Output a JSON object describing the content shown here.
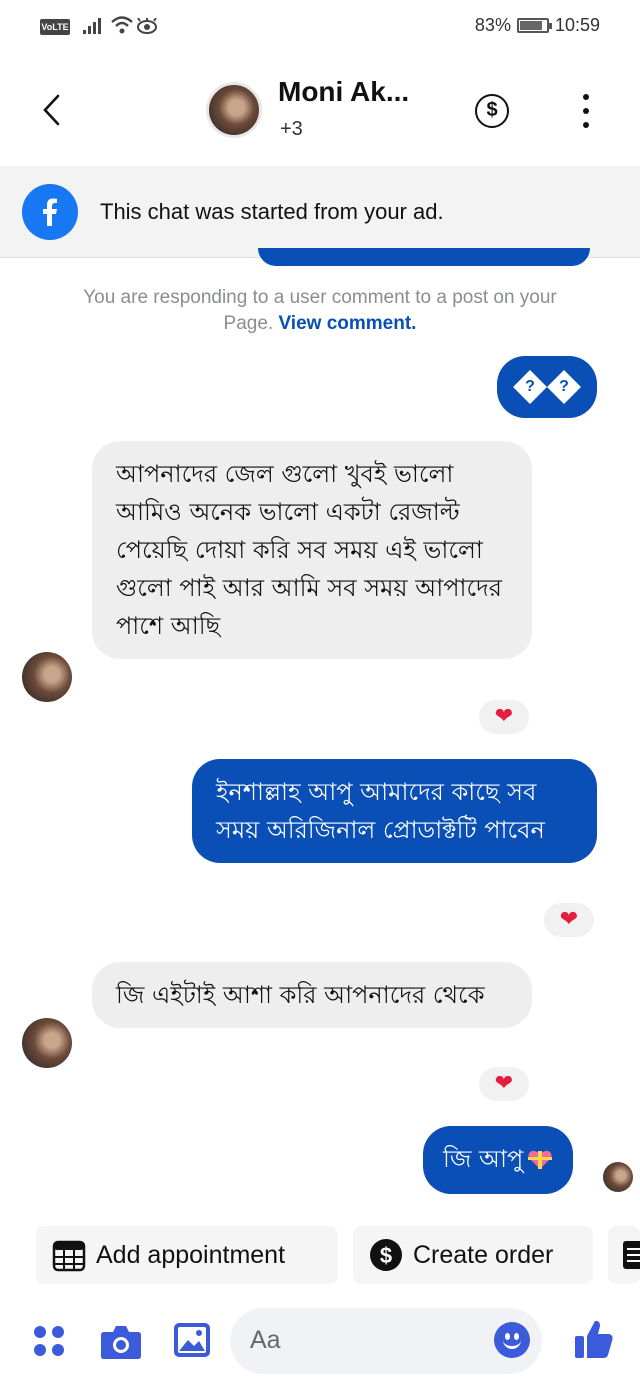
{
  "status_bar": {
    "volte": "VoLTE",
    "battery_percent": "83%",
    "battery_level": 0.83,
    "time": "10:59"
  },
  "header": {
    "title": "Moni Ak...",
    "subtitle": "+3"
  },
  "banner": {
    "text": "This chat was started from your ad."
  },
  "notice": {
    "text": "You are responding to a user comment to a post on your Page.",
    "link": "View comment."
  },
  "messages": [
    {
      "side": "out",
      "text": "",
      "glyphs": [
        "?",
        "?"
      ]
    },
    {
      "side": "in",
      "text": "আপনাদের জেল গুলো খুবই ভালো আমিও অনেক ভালো একটা রেজাল্ট পেয়েছি দোয়া করি সব সময় এই ভালো গুলো পাই আর আমি সব সময় আপাদের পাশে আছি",
      "reaction": "❤"
    },
    {
      "side": "out",
      "text": "ইনশাল্লাহ আপু আমাদের কাছে সব সময় অরিজিনাল প্রোডাক্টটি পাবেন",
      "reaction": "❤"
    },
    {
      "side": "in",
      "text": "জি এইটাই আশা করি আপনাদের থেকে",
      "reaction": "❤"
    },
    {
      "side": "out",
      "text": "জি আপু",
      "emoji": "gift-heart"
    }
  ],
  "quick_actions": [
    {
      "label": "Add appointment",
      "icon": "calendar-icon"
    },
    {
      "label": "Create order",
      "icon": "dollar-icon"
    }
  ],
  "composer": {
    "placeholder": "Aa"
  },
  "colors": {
    "accent": "#0a4fb5",
    "messenger_blue": "#1877f2",
    "incoming_bubble": "#eeeeee",
    "heart": "#e41e3f"
  }
}
